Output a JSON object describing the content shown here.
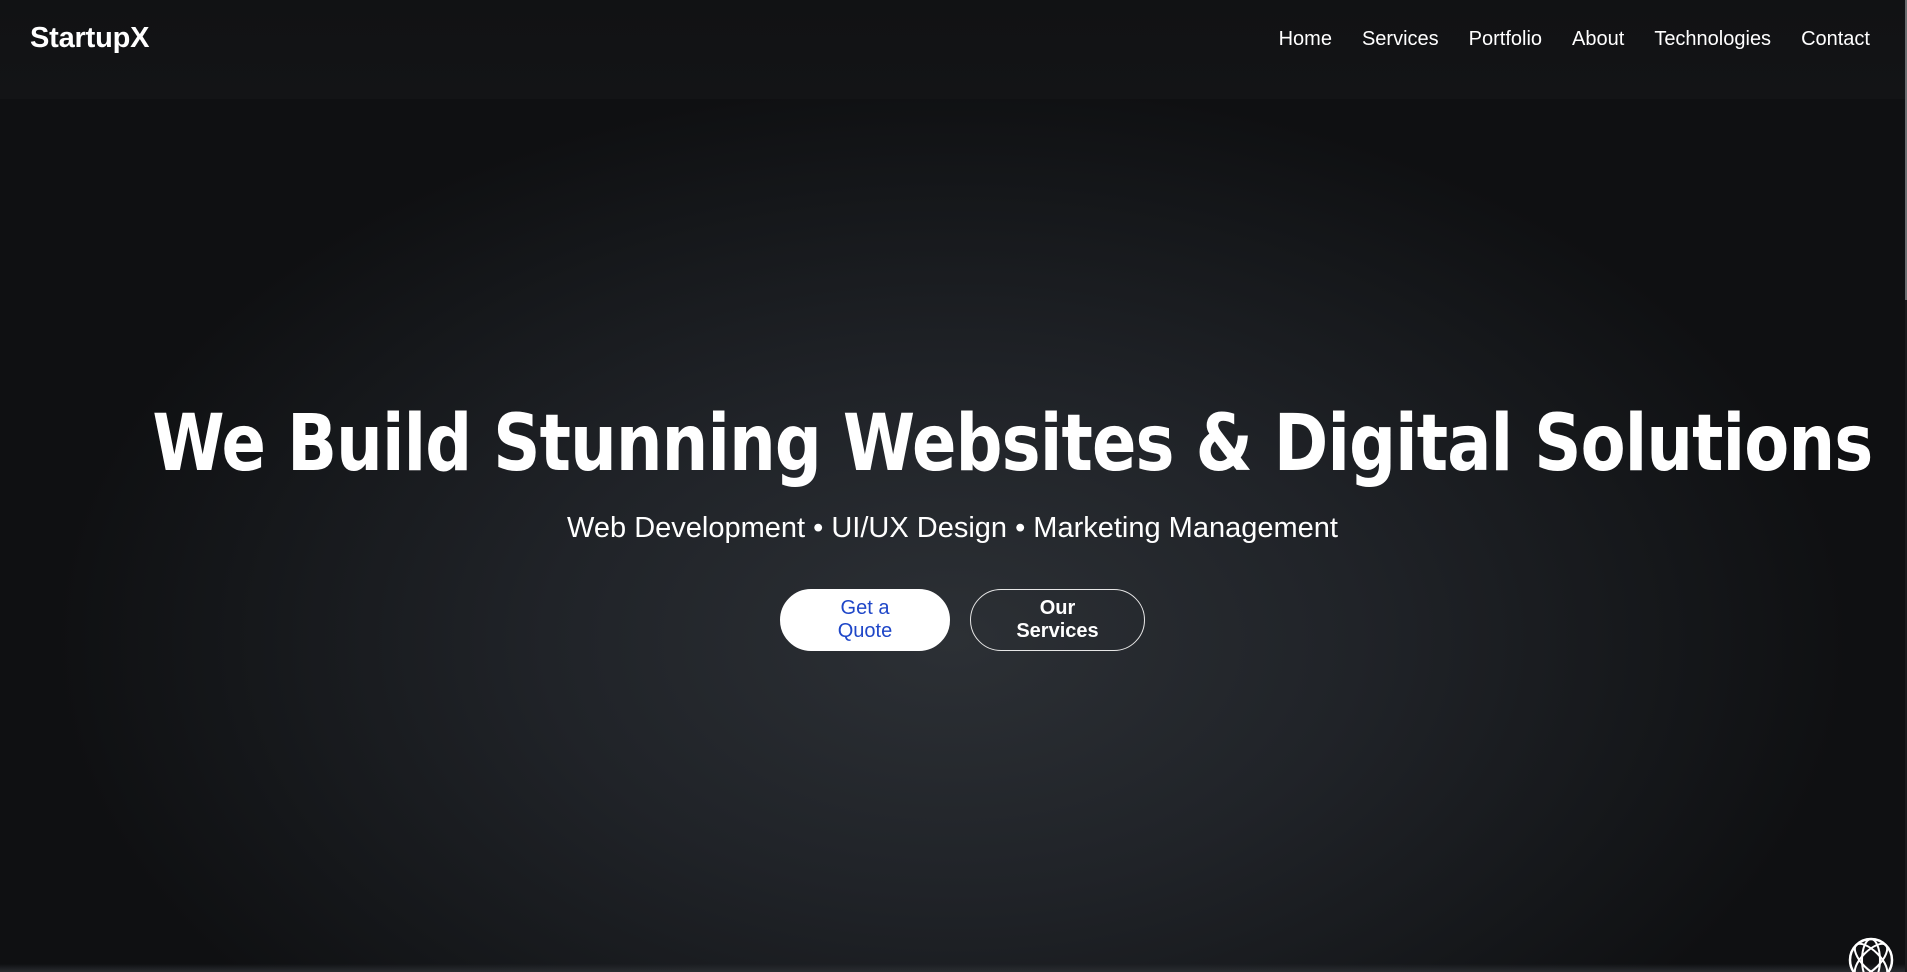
{
  "brand": {
    "name": "StartupX"
  },
  "nav": {
    "items": [
      {
        "label": "Home"
      },
      {
        "label": "Services"
      },
      {
        "label": "Portfolio"
      },
      {
        "label": "About"
      },
      {
        "label": "Technologies"
      },
      {
        "label": "Contact"
      }
    ]
  },
  "hero": {
    "title": "We Build Stunning Websites & Digital Solutions",
    "subtitle": "Web Development • UI/UX Design • Marketing Management",
    "primary_button": "Get a Quote",
    "secondary_button": "Our Services"
  },
  "colors": {
    "background": "#1f2226",
    "text": "#ffffff",
    "primary_button_text": "#1e46c8",
    "primary_button_bg": "#ffffff"
  },
  "icons": {
    "corner_widget": "chat-widget-icon"
  }
}
